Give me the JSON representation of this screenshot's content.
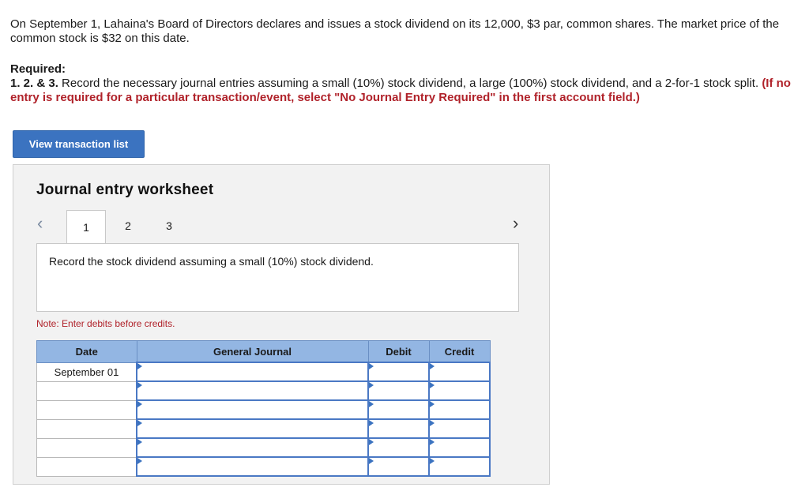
{
  "problem_text": "On September 1, Lahaina's Board of Directors declares and issues a stock dividend on its 12,000, $3 par, common shares. The market price of the common stock is $32 on this date.",
  "required": {
    "heading": "Required:",
    "numbers": "1. 2. & 3.",
    "text": "Record the necessary journal entries assuming a small (10%) stock dividend, a large (100%) stock dividend, and a 2-for-1 stock split.",
    "red_text": "(If no entry is required for a particular transaction/event, select \"No Journal Entry Required\" in the first account field.)"
  },
  "view_button_label": "View transaction list",
  "worksheet": {
    "title": "Journal entry worksheet",
    "tabs": [
      "1",
      "2",
      "3"
    ],
    "active_tab": "1",
    "instruction": "Record the stock dividend assuming a small (10%) stock dividend.",
    "note": "Note: Enter debits before credits.",
    "columns": [
      "Date",
      "General Journal",
      "Debit",
      "Credit"
    ],
    "rows": [
      {
        "date": "September 01"
      },
      {
        "date": ""
      },
      {
        "date": ""
      },
      {
        "date": ""
      },
      {
        "date": ""
      },
      {
        "date": ""
      }
    ]
  },
  "colors": {
    "button_blue": "#3b73c0",
    "header_blue": "#93b6e3",
    "alert_red": "#b0222a"
  }
}
